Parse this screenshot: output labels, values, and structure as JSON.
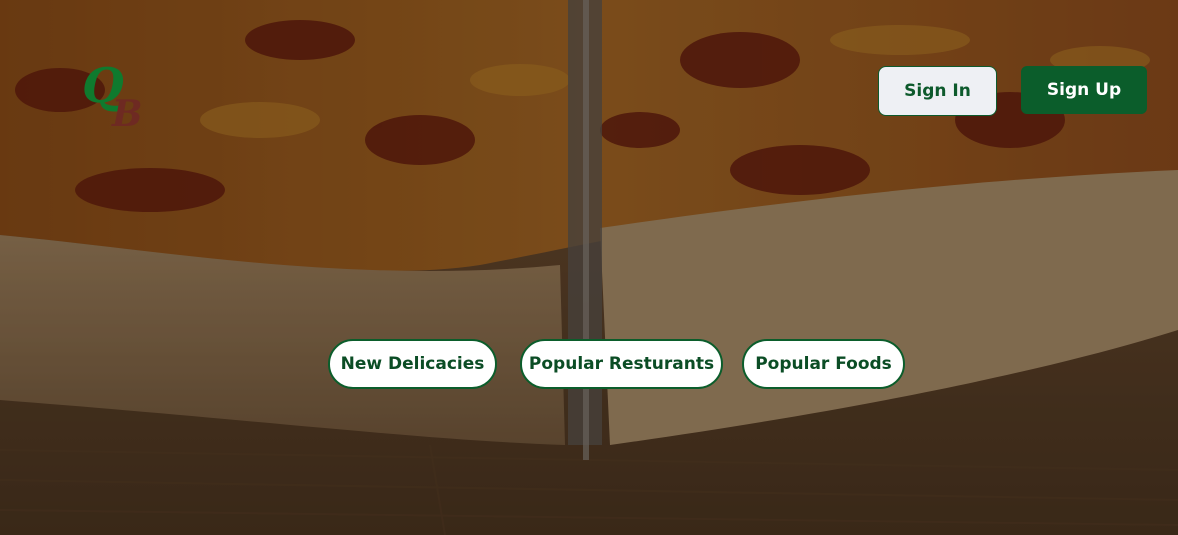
{
  "logo": {
    "letter_top": "Q",
    "letter_bottom": "B"
  },
  "auth": {
    "sign_in_label": "Sign In",
    "sign_up_label": "Sign Up"
  },
  "categories": [
    {
      "label": "New Delicacies"
    },
    {
      "label": "Popular Resturants"
    },
    {
      "label": "Popular Foods"
    }
  ],
  "colors": {
    "brand_green": "#0b5d2b",
    "logo_green": "#0f7a2e",
    "logo_maroon": "#6e2a22"
  }
}
